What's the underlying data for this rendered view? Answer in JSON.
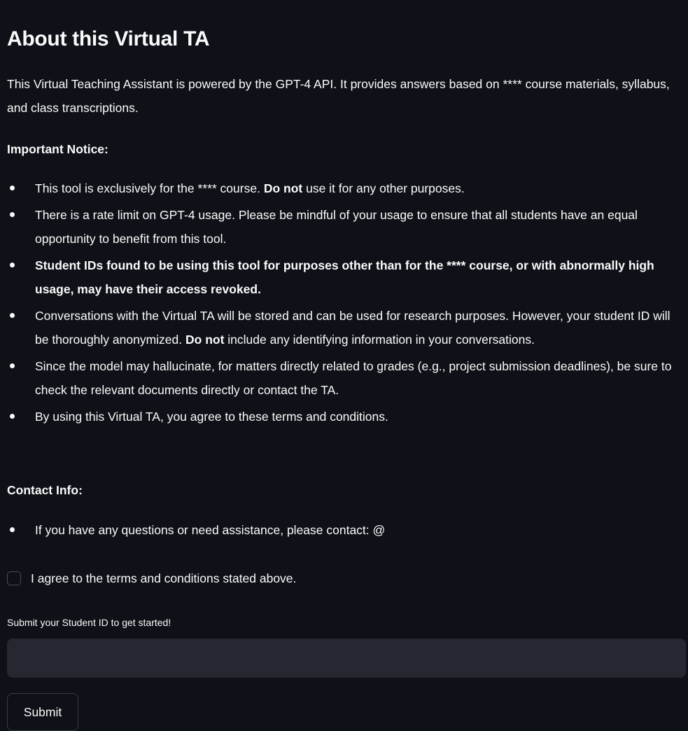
{
  "heading": {
    "title": "About this Virtual TA"
  },
  "intro": {
    "text": "This Virtual Teaching Assistant is powered by the GPT-4 API. It provides answers based on **** course materials, syllabus, and class transcriptions."
  },
  "notice": {
    "label": "Important Notice:",
    "items": [
      {
        "pre": "This tool is exclusively for the **** course. ",
        "bold": "Do not",
        "post": " use it for any other purposes."
      },
      {
        "text": "There is a rate limit on GPT-4 usage. Please be mindful of your usage to ensure that all students have an equal opportunity to benefit from this tool."
      },
      {
        "text": "Student IDs found to be using this tool for purposes other than for the **** course, or with abnormally high usage, may have their access revoked."
      },
      {
        "pre": "Conversations with the Virtual TA will be stored and can be used for research purposes. However, your student ID will be thoroughly anonymized. ",
        "bold": "Do not",
        "post": " include any identifying information in your conversations."
      },
      {
        "text": "Since the model may hallucinate, for matters directly related to grades (e.g., project submission deadlines), be sure to check the relevant documents directly or contact the TA."
      },
      {
        "text": "By using this Virtual TA, you agree to these terms and conditions."
      }
    ]
  },
  "contact": {
    "label": "Contact Info:",
    "items": [
      {
        "text": "If you have any questions or need assistance, please contact: @"
      }
    ]
  },
  "agreement": {
    "label": "I agree to the terms and conditions stated above.",
    "checked": false
  },
  "student_id": {
    "label": "Submit your Student ID to get started!",
    "value": "",
    "placeholder": ""
  },
  "submit": {
    "label": "Submit"
  },
  "theme": {
    "background": "#0e1117",
    "text": "#fafafa",
    "input_background": "#262730"
  }
}
